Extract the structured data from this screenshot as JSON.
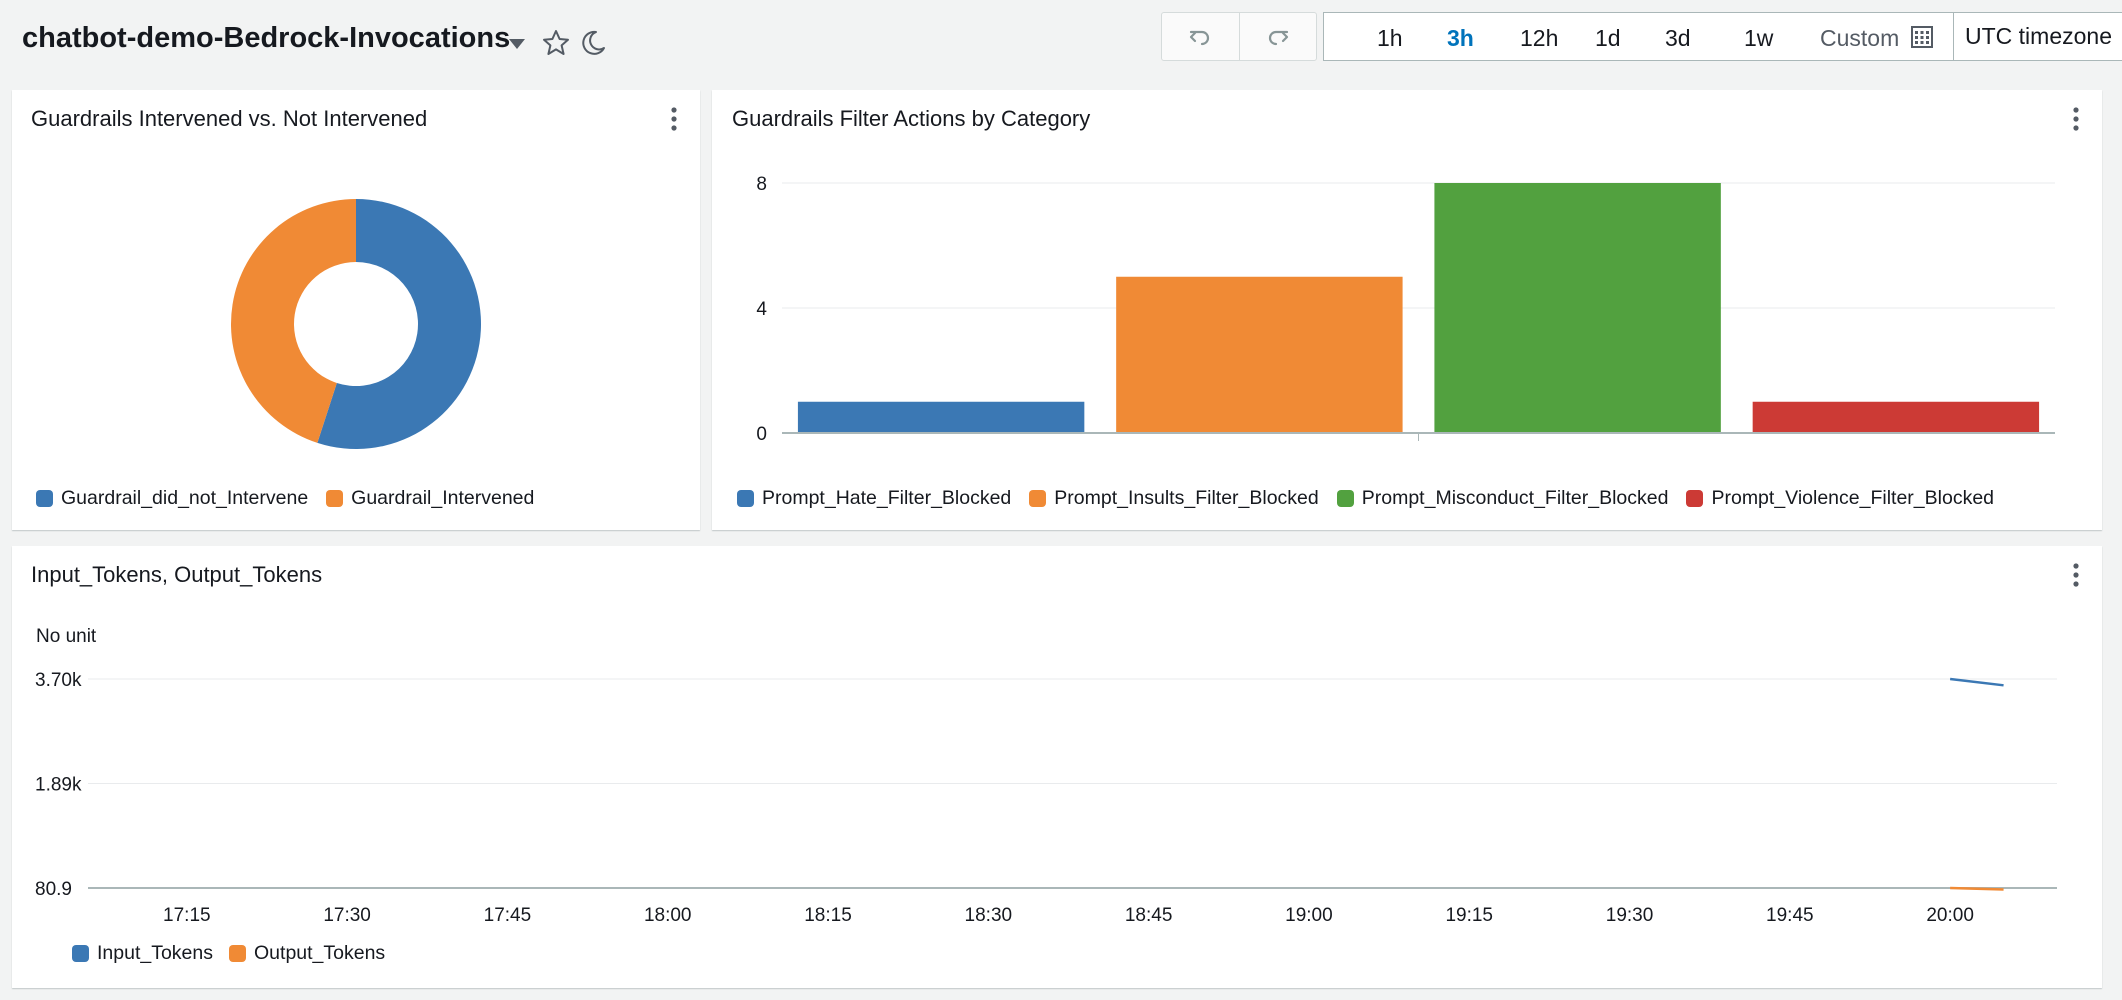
{
  "header": {
    "dashboard_title": "chatbot-demo-Bedrock-Invocations",
    "time_ranges": [
      "1h",
      "3h",
      "12h",
      "1d",
      "3d",
      "1w"
    ],
    "active_range": "3h",
    "custom_label": "Custom",
    "timezone_label": "UTC timezone"
  },
  "colors": {
    "blue": "#3b78b4",
    "orange": "#f08a35",
    "green": "#52a13f",
    "red": "#cc3a35",
    "accent": "#0073bb"
  },
  "widgets": {
    "donut": {
      "title": "Guardrails Intervened vs. Not Intervened"
    },
    "bars": {
      "title": "Guardrails Filter Actions by Category"
    },
    "line": {
      "title": "Input_Tokens, Output_Tokens",
      "unit_label": "No unit"
    }
  },
  "chart_data": [
    {
      "type": "pie",
      "title": "Guardrails Intervened vs. Not Intervened",
      "donut": true,
      "slices": [
        {
          "name": "Guardrail_did_not_Intervene",
          "value": 55,
          "color": "#3b78b4"
        },
        {
          "name": "Guardrail_Intervened",
          "value": 45,
          "color": "#f08a35"
        }
      ],
      "legend_position": "bottom-left"
    },
    {
      "type": "bar",
      "title": "Guardrails Filter Actions by Category",
      "categories": [
        "Prompt_Hate_Filter_Blocked",
        "Prompt_Insults_Filter_Blocked",
        "Prompt_Misconduct_Filter_Blocked",
        "Prompt_Violence_Filter_Blocked"
      ],
      "values": [
        1,
        5,
        8,
        1
      ],
      "colors": [
        "#3b78b4",
        "#f08a35",
        "#52a13f",
        "#cc3a35"
      ],
      "ylim": [
        0,
        8
      ],
      "yticks": [
        "0",
        "4",
        "8"
      ],
      "grid": true,
      "legend_position": "bottom-left"
    },
    {
      "type": "line",
      "title": "Input_Tokens, Output_Tokens",
      "ylabel": "No unit",
      "ylim": [
        80.9,
        3700
      ],
      "yticks": [
        {
          "value": 3700,
          "label": "3.70k"
        },
        {
          "value": 1890,
          "label": "1.89k"
        },
        {
          "value": 80.9,
          "label": "80.9"
        }
      ],
      "xticks": [
        "17:15",
        "17:30",
        "17:45",
        "18:00",
        "18:15",
        "18:30",
        "18:45",
        "19:00",
        "19:15",
        "19:30",
        "19:45",
        "20:00"
      ],
      "xrange": [
        "17:08",
        "20:10"
      ],
      "series": [
        {
          "name": "Input_Tokens",
          "color": "#3b78b4",
          "points": [
            {
              "x": "20:00",
              "y": 3700
            },
            {
              "x": "20:05",
              "y": 3590
            }
          ]
        },
        {
          "name": "Output_Tokens",
          "color": "#f08a35",
          "points": [
            {
              "x": "20:00",
              "y": 80.9
            },
            {
              "x": "20:05",
              "y": 55
            }
          ]
        }
      ],
      "grid": true,
      "legend_position": "bottom-left"
    }
  ]
}
